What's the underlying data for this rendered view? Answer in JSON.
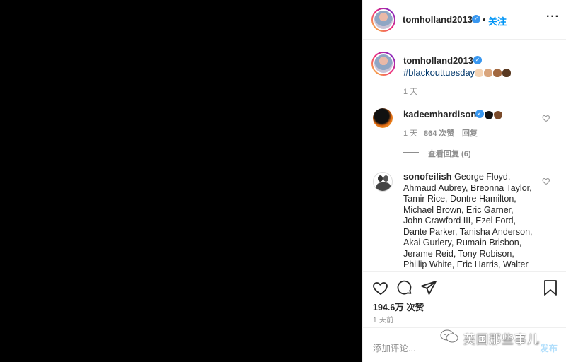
{
  "header": {
    "username": "tomholland2013",
    "separator": "•",
    "follow_label": "关注",
    "more_icon": "more-horizontal-icon"
  },
  "caption": {
    "username": "tomholland2013",
    "hashtag": "#blackouttuesday",
    "emojis": [
      "raised-fist-light",
      "raised-fist-medium-light",
      "raised-fist-medium-dark",
      "raised-fist-dark"
    ],
    "time": "1 天"
  },
  "comments": [
    {
      "username": "kadeemhardison",
      "verified": true,
      "text_emojis": [
        "black-heart",
        "brown-heart"
      ],
      "time": "1 天",
      "likes": "864 次赞",
      "reply_label": "回复",
      "view_replies": "查看回复 (6)"
    },
    {
      "username": "sonofeilish",
      "verified": false,
      "text": "George Floyd, Ahmaud Aubrey, Breonna Taylor, Tamir Rice, Dontre Hamilton, Michael Brown, Eric Garner, John Crawford III, Ezel Ford, Dante Parker, Tanisha Anderson, Akai Gurlery, Rumain Brisbon, Jerame Reid, Tony Robison, Phillip White, Eric Harris, Walter"
    }
  ],
  "actions": {
    "likes": "194.6万 次赞",
    "posted": "1 天前",
    "icons": [
      "heart-icon",
      "comment-icon",
      "share-icon",
      "bookmark-icon"
    ]
  },
  "add_comment": {
    "placeholder": "添加评论...",
    "post_label": "发布"
  },
  "watermark": "英国那些事儿",
  "colors": {
    "link_blue": "#0095f6",
    "hashtag_blue": "#00376b",
    "verified_blue": "#3897f0",
    "muted_gray": "#8e8e8e"
  }
}
